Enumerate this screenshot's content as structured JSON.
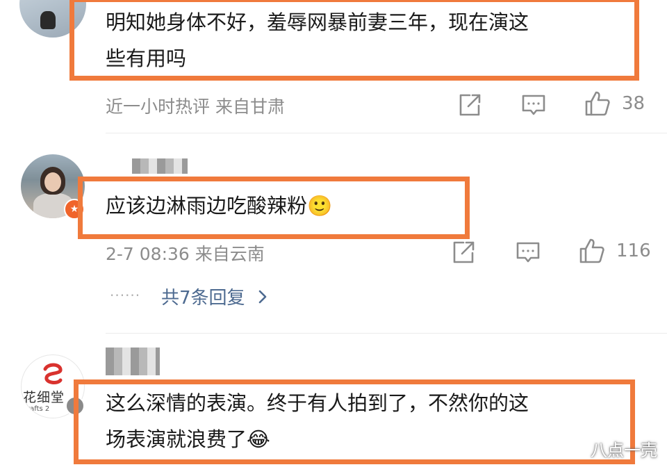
{
  "comments": [
    {
      "text_lines": [
        "明知她身体不好，羞辱网暴前妻三年，现在演这",
        "些有用吗"
      ],
      "meta": "近一小时热评  来自甘肃",
      "likes": "38"
    },
    {
      "text_lines": [
        "应该边淋雨边吃酸辣粉🙂"
      ],
      "meta": "2-7 08:36  来自云南",
      "likes": "116",
      "replies_label": "共7条回复",
      "replies_dots": "······"
    },
    {
      "text_lines": [
        "这么深情的表演。终于有人拍到了，不然你的这",
        "场表演就浪费了😂"
      ],
      "avatar_logo_text": "花细堂",
      "avatar_logo_sub": "rafts 2"
    }
  ],
  "icons": {
    "share": "share-icon",
    "comment": "comment-icon",
    "like": "thumbs-up-icon",
    "chevron": "chevron-right-icon"
  },
  "colors": {
    "highlight_border": "#f07a3c",
    "meta_text": "#8c8c8c",
    "link_text": "#4d6a90"
  },
  "watermark": "八点一壳"
}
